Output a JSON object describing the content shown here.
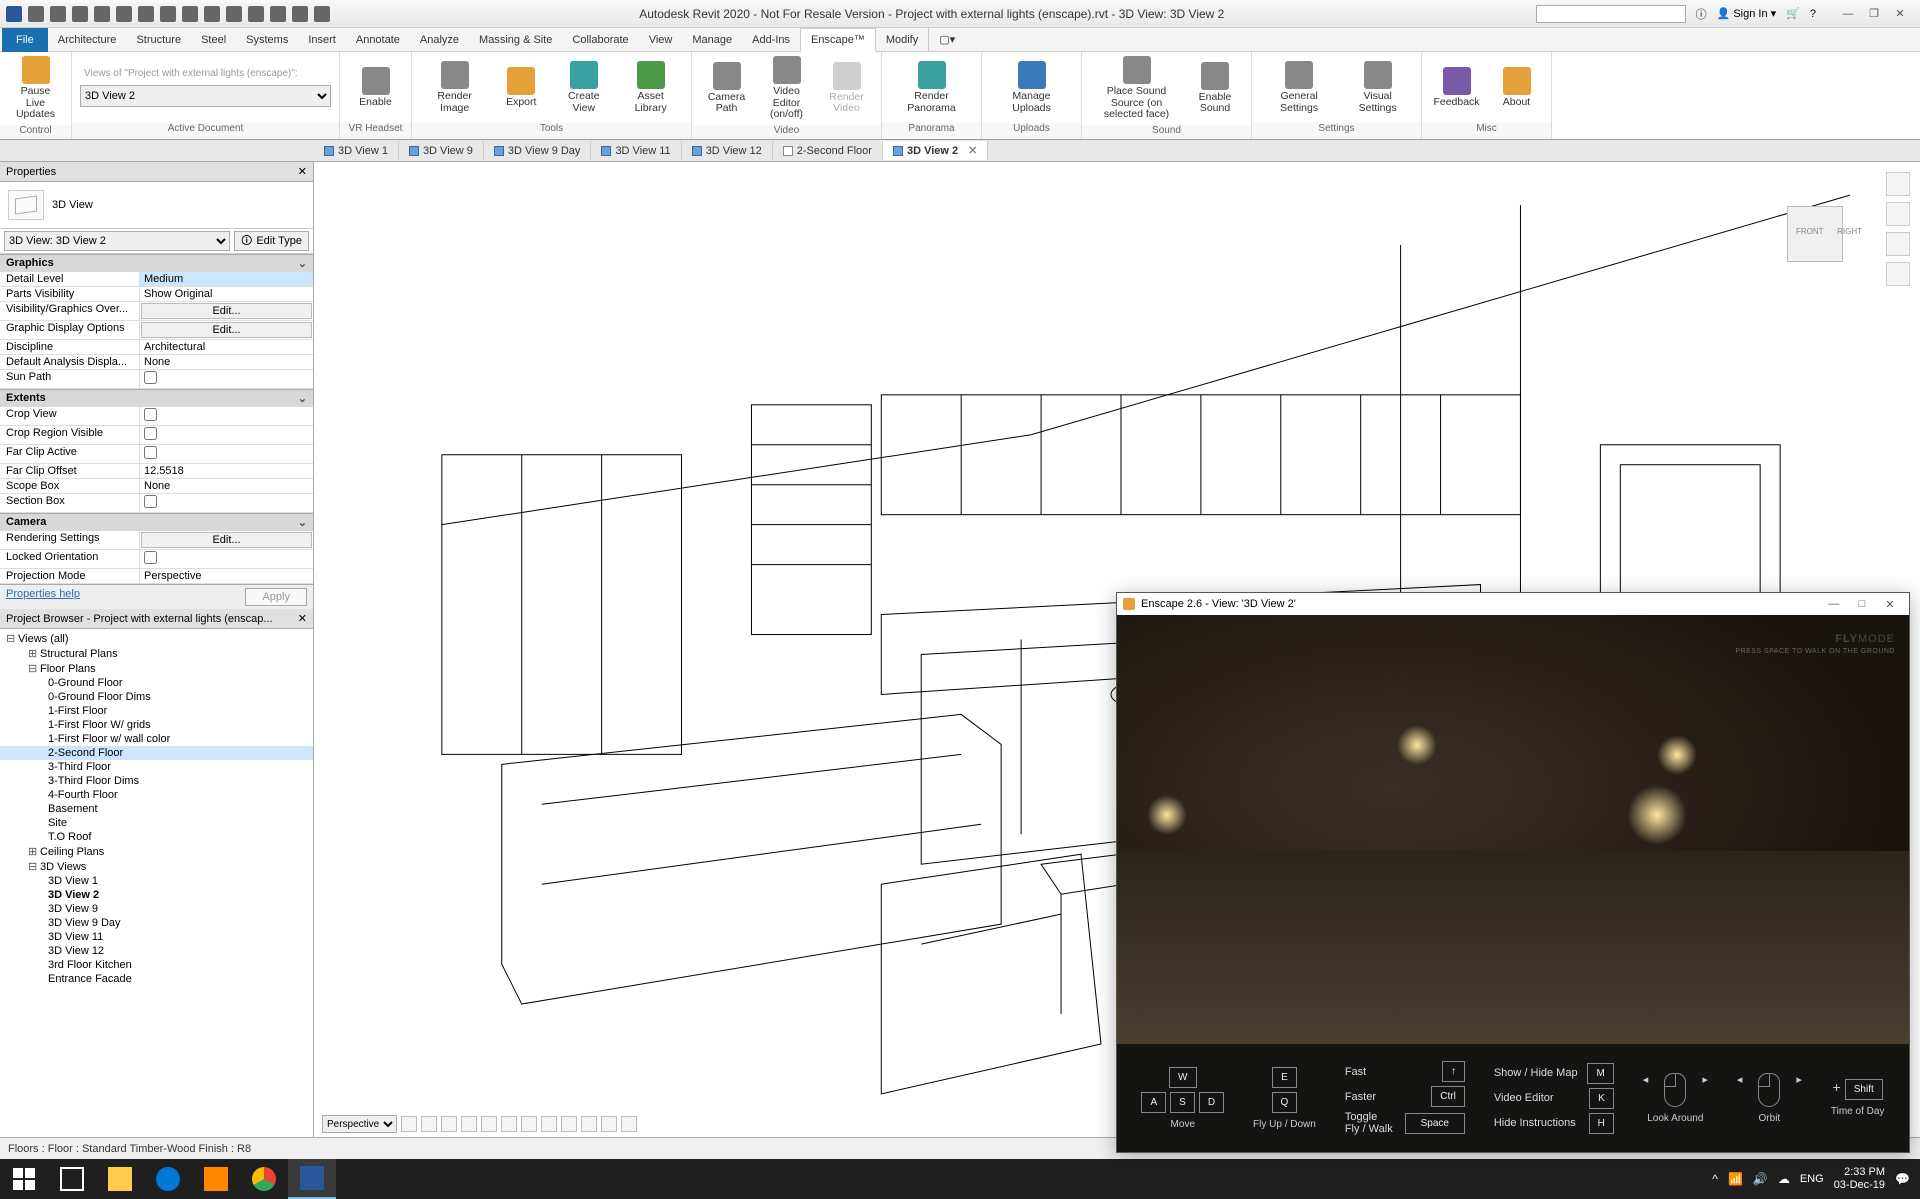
{
  "title": "Autodesk Revit 2020 - Not For Resale Version - Project with external lights (enscape).rvt - 3D View: 3D View 2",
  "signin": "Sign In",
  "file_tab": "File",
  "ribbon_tabs": [
    "Architecture",
    "Structure",
    "Steel",
    "Systems",
    "Insert",
    "Annotate",
    "Analyze",
    "Massing & Site",
    "Collaborate",
    "View",
    "Manage",
    "Add-Ins",
    "Enscape™",
    "Modify"
  ],
  "active_ribbon_tab": 12,
  "ribbon": {
    "control": {
      "pause": "Pause\nLive Updates",
      "label": "Control"
    },
    "activedoc": {
      "views_of": "Views of \"Project with external lights (enscape)\":",
      "view_sel": "3D View 2",
      "label": "Active Document"
    },
    "vr": {
      "enable": "Enable",
      "label": "VR Headset"
    },
    "tools": {
      "render": "Render Image",
      "export": "Export",
      "create": "Create View",
      "asset": "Asset Library",
      "label": "Tools"
    },
    "video": {
      "camera": "Camera\nPath",
      "veditor": "Video Editor\n(on/off)",
      "rvideo": "Render Video",
      "label": "Video"
    },
    "panorama": {
      "render": "Render Panorama",
      "label": "Panorama"
    },
    "uploads": {
      "manage": "Manage Uploads",
      "label": "Uploads"
    },
    "sound": {
      "place": "Place Sound Source\n(on selected face)",
      "enable": "Enable\nSound",
      "label": "Sound"
    },
    "settings": {
      "general": "General Settings",
      "visual": "Visual Settings",
      "label": "Settings"
    },
    "misc": {
      "feedback": "Feedback",
      "about": "About",
      "label": "Misc"
    }
  },
  "view_tabs": [
    {
      "label": "3D View 1",
      "type": "3d"
    },
    {
      "label": "3D View 9",
      "type": "3d"
    },
    {
      "label": "3D View 9 Day",
      "type": "3d"
    },
    {
      "label": "3D View 11",
      "type": "3d"
    },
    {
      "label": "3D View 12",
      "type": "3d"
    },
    {
      "label": "2-Second Floor",
      "type": "sheet"
    },
    {
      "label": "3D View 2",
      "type": "3d",
      "active": true
    }
  ],
  "properties": {
    "title": "Properties",
    "type_name": "3D View",
    "selector": "3D View: 3D View 2",
    "edit_type": "Edit Type",
    "help": "Properties help",
    "apply": "Apply",
    "sections": [
      {
        "name": "Graphics",
        "rows": [
          {
            "k": "Detail Level",
            "v": "Medium",
            "kind": "text",
            "sel": true
          },
          {
            "k": "Parts Visibility",
            "v": "Show Original",
            "kind": "text"
          },
          {
            "k": "Visibility/Graphics Over...",
            "v": "Edit...",
            "kind": "btn"
          },
          {
            "k": "Graphic Display Options",
            "v": "Edit...",
            "kind": "btn"
          },
          {
            "k": "Discipline",
            "v": "Architectural",
            "kind": "text"
          },
          {
            "k": "Default Analysis Displa...",
            "v": "None",
            "kind": "text"
          },
          {
            "k": "Sun Path",
            "v": "",
            "kind": "check",
            "checked": false
          }
        ]
      },
      {
        "name": "Extents",
        "rows": [
          {
            "k": "Crop View",
            "v": "",
            "kind": "check",
            "checked": false
          },
          {
            "k": "Crop Region Visible",
            "v": "",
            "kind": "check",
            "checked": false
          },
          {
            "k": "Far Clip Active",
            "v": "",
            "kind": "check",
            "checked": false
          },
          {
            "k": "Far Clip Offset",
            "v": "12.5518",
            "kind": "text"
          },
          {
            "k": "Scope Box",
            "v": "None",
            "kind": "text"
          },
          {
            "k": "Section Box",
            "v": "",
            "kind": "check",
            "checked": false
          }
        ]
      },
      {
        "name": "Camera",
        "rows": [
          {
            "k": "Rendering Settings",
            "v": "Edit...",
            "kind": "btn"
          },
          {
            "k": "Locked Orientation",
            "v": "",
            "kind": "check",
            "checked": false
          },
          {
            "k": "Projection Mode",
            "v": "Perspective",
            "kind": "text"
          }
        ]
      }
    ]
  },
  "browser": {
    "title": "Project Browser - Project with external lights (enscap...",
    "items": [
      {
        "l": 0,
        "label": "Views (all)",
        "tw": "−"
      },
      {
        "l": 1,
        "label": "Structural Plans",
        "tw": "+"
      },
      {
        "l": 1,
        "label": "Floor Plans",
        "tw": "−"
      },
      {
        "l": 2,
        "label": "0-Ground Floor"
      },
      {
        "l": 2,
        "label": "0-Ground Floor Dims"
      },
      {
        "l": 2,
        "label": "1-First Floor"
      },
      {
        "l": 2,
        "label": "1-First Floor  W/ grids"
      },
      {
        "l": 2,
        "label": "1-First Floor w/ wall color"
      },
      {
        "l": 2,
        "label": "2-Second Floor",
        "sel": true
      },
      {
        "l": 2,
        "label": "3-Third Floor"
      },
      {
        "l": 2,
        "label": "3-Third Floor Dims"
      },
      {
        "l": 2,
        "label": "4-Fourth Floor"
      },
      {
        "l": 2,
        "label": "Basement"
      },
      {
        "l": 2,
        "label": "Site"
      },
      {
        "l": 2,
        "label": "T.O Roof"
      },
      {
        "l": 1,
        "label": "Ceiling Plans",
        "tw": "+"
      },
      {
        "l": 1,
        "label": "3D Views",
        "tw": "−"
      },
      {
        "l": 2,
        "label": "3D View 1"
      },
      {
        "l": 2,
        "label": "3D View 2",
        "bold": true
      },
      {
        "l": 2,
        "label": "3D View 9"
      },
      {
        "l": 2,
        "label": "3D View 9 Day"
      },
      {
        "l": 2,
        "label": "3D View 11"
      },
      {
        "l": 2,
        "label": "3D View 12"
      },
      {
        "l": 2,
        "label": "3rd Floor Kitchen"
      },
      {
        "l": 2,
        "label": "Entrance Facade"
      }
    ]
  },
  "viewport": {
    "projection": "Perspective",
    "viewcube": {
      "front": "FRONT",
      "right": "RIGHT"
    }
  },
  "enscape": {
    "title": "Enscape 2.6 - View: '3D View 2'",
    "flymode": "MODE",
    "flymode_pre": "FLY",
    "flymode_sub": "PRESS SPACE TO WALK ON THE GROUND",
    "help": {
      "move": "Move",
      "flyupdown": "Fly Up / Down",
      "fast": "Fast",
      "faster": "Faster",
      "toggle": "Toggle\nFly / Walk",
      "showmap": "Show / Hide Map",
      "videoed": "Video Editor",
      "hideinst": "Hide Instructions",
      "lookaround": "Look Around",
      "orbit": "Orbit",
      "timeofday": "Time of Day",
      "keys": {
        "W": "W",
        "A": "A",
        "S": "S",
        "D": "D",
        "E": "E",
        "Q": "Q",
        "Shift": "↑",
        "Ctrl": "Ctrl",
        "Space": "Space",
        "M": "M",
        "K": "K",
        "H": "H",
        "ShiftK": "Shift"
      }
    }
  },
  "statusbar": "Floors : Floor : Standard Timber-Wood Finish : R8",
  "taskbar": {
    "time": "2:33 PM",
    "date": "03-Dec-19",
    "lang": "ENG"
  }
}
